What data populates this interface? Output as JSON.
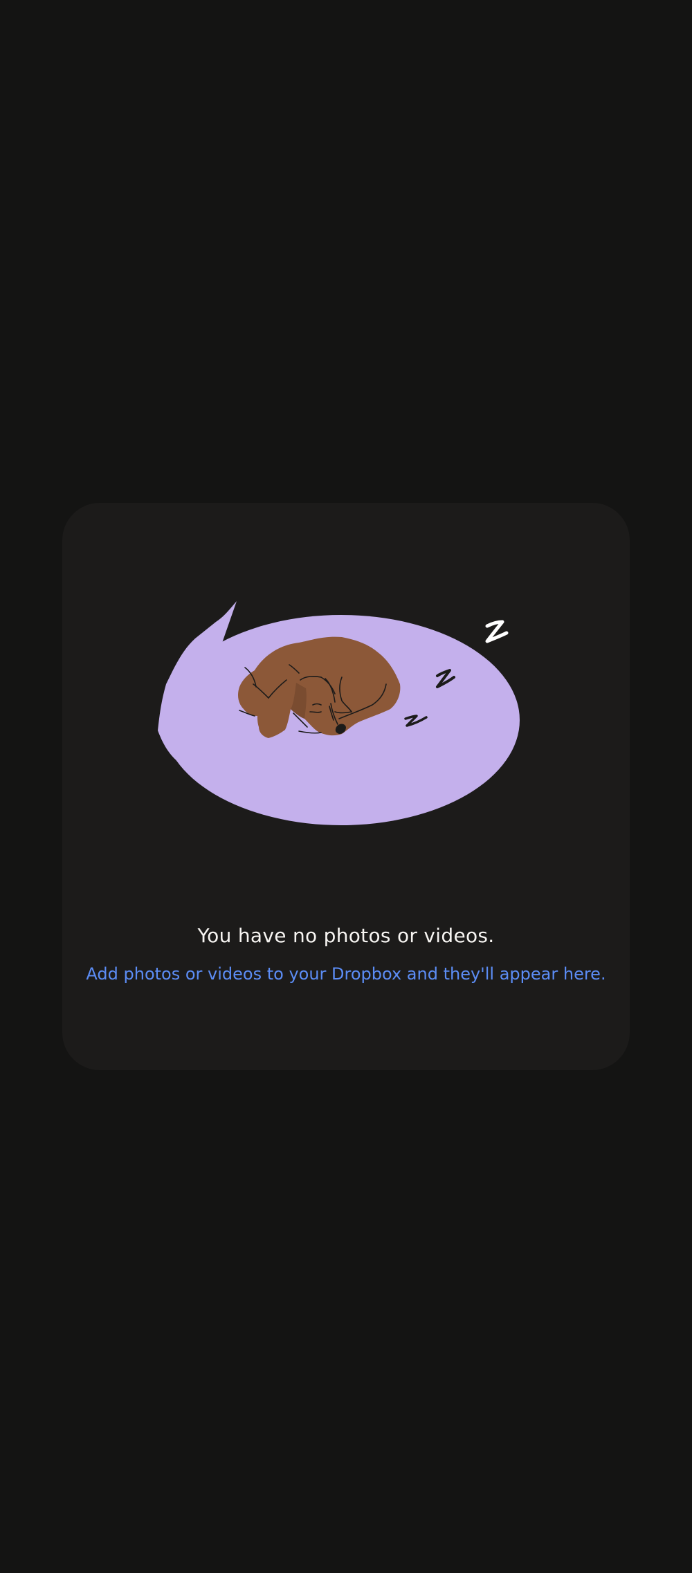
{
  "empty_state": {
    "title": "You have no photos or videos.",
    "subtitle": "Add photos or videos to your Dropbox and they'll appear here.",
    "illustration": "sleeping-dog-on-cushion"
  },
  "colors": {
    "page_background": "#141413",
    "card_background": "#1c1b1a",
    "cushion": "#c4b0ec",
    "dog": "#8c5838",
    "title_text": "#f7f5f2",
    "link_text": "#5c8df5"
  }
}
